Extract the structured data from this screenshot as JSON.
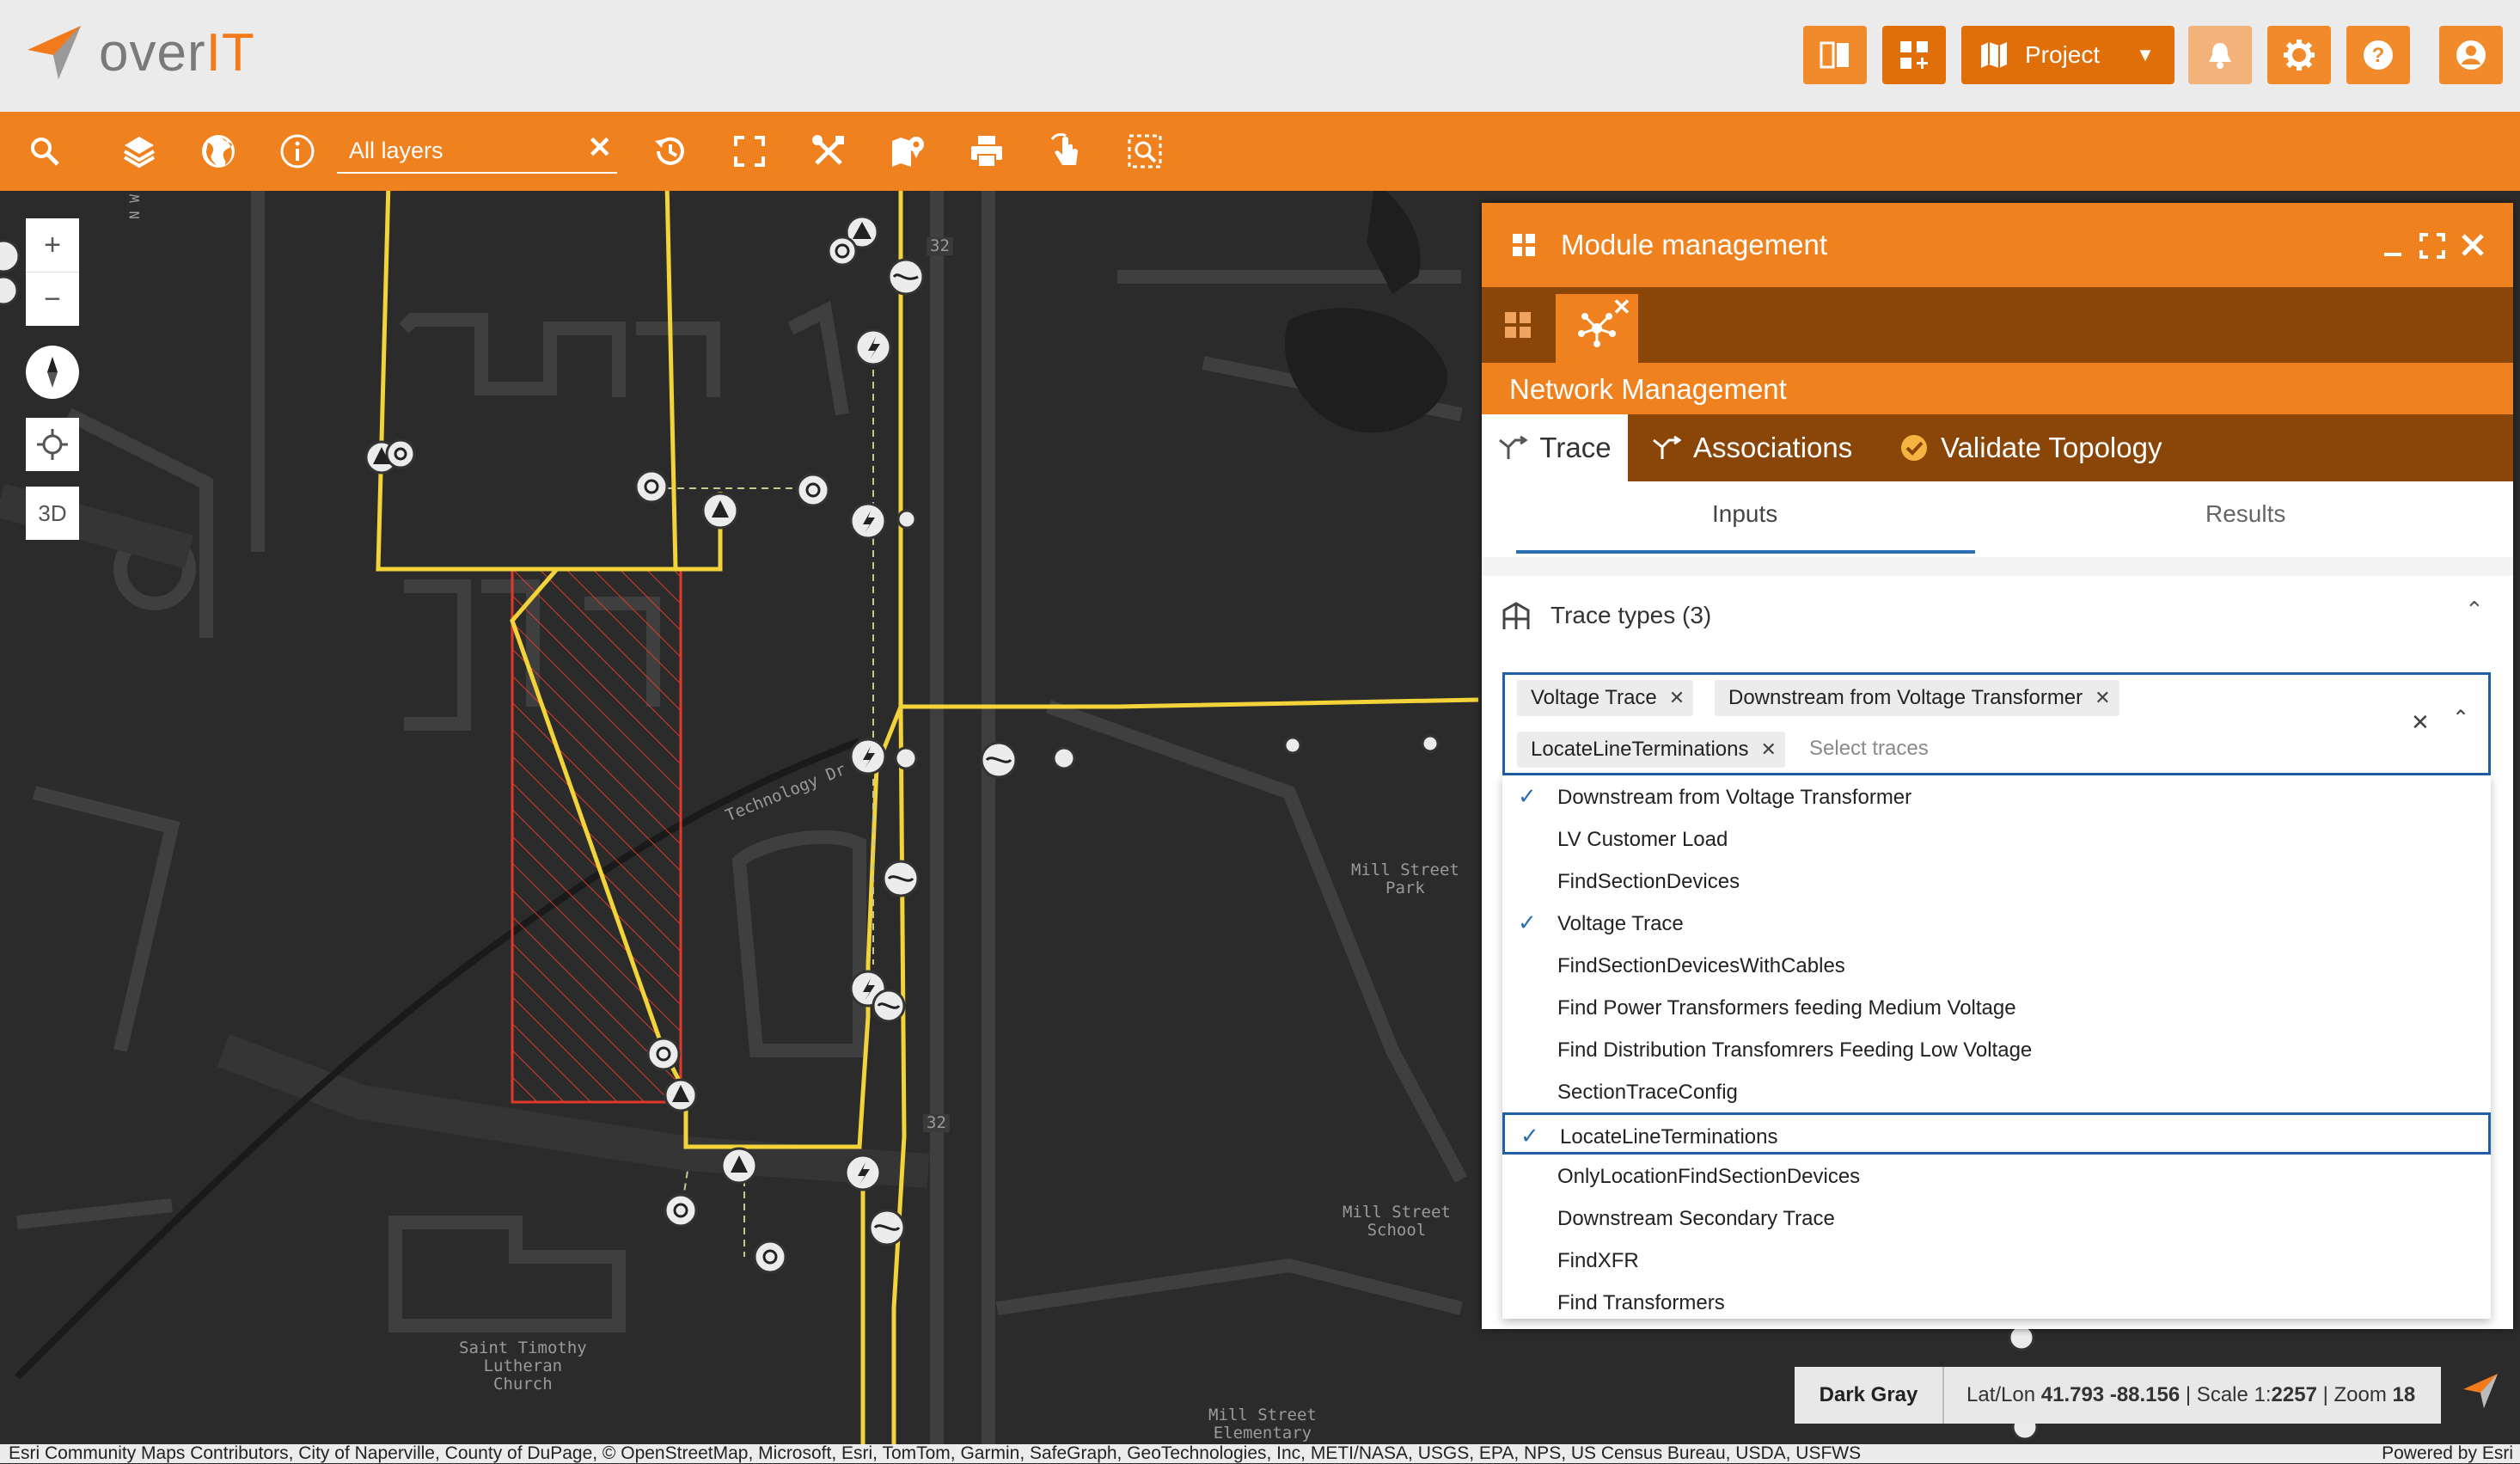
{
  "app": {
    "logo_text_a": "over",
    "logo_text_b": "IT"
  },
  "header": {
    "project_label": "Project",
    "buttons": [
      "split-view-icon",
      "add-widget-icon",
      "map-icon",
      "bell-icon",
      "gear-icon",
      "help-icon",
      "user-icon"
    ]
  },
  "toolbar": {
    "search_value": "All layers",
    "clear_symbol": "✕"
  },
  "map": {
    "zoom_in": "+",
    "zoom_out": "−",
    "mode_3d": "3D",
    "labels": {
      "road_technology": "Technology Dr",
      "park": "Mill Street\nPark",
      "school": "Mill Street\nSchool",
      "church": "Saint Timothy\nLutheran\nChurch",
      "elementary": "Mill Street\nElementary",
      "route_32_top": "32",
      "route_32_bottom": "32",
      "nw": "N W"
    }
  },
  "panel": {
    "title": "Module management",
    "network_title": "Network Management",
    "subtabs": {
      "trace": "Trace",
      "associations": "Associations",
      "validate": "Validate Topology"
    },
    "io_tabs": {
      "inputs": "Inputs",
      "results": "Results"
    },
    "trace_types_label": "Trace types (3)",
    "chips": [
      "Voltage Trace",
      "Downstream from Voltage Transformer",
      "LocateLineTerminations"
    ],
    "placeholder": "Select traces",
    "options": [
      {
        "label": "Downstream from Voltage Transformer",
        "checked": true
      },
      {
        "label": "LV Customer Load",
        "checked": false
      },
      {
        "label": "FindSectionDevices",
        "checked": false
      },
      {
        "label": "Voltage Trace",
        "checked": true
      },
      {
        "label": "FindSectionDevicesWithCables",
        "checked": false
      },
      {
        "label": "Find Power Transformers feeding Medium Voltage",
        "checked": false
      },
      {
        "label": "Find Distribution Transfomrers Feeding Low Voltage",
        "checked": false
      },
      {
        "label": "SectionTraceConfig",
        "checked": false
      },
      {
        "label": "LocateLineTerminations",
        "checked": true,
        "focused": true
      },
      {
        "label": "OnlyLocationFindSectionDevices",
        "checked": false
      },
      {
        "label": "Downstream Secondary Trace",
        "checked": false
      },
      {
        "label": "FindXFR",
        "checked": false
      },
      {
        "label": "Find Transformers",
        "checked": false
      }
    ]
  },
  "status": {
    "basemap": "Dark Gray",
    "latlon_label": "Lat/Lon ",
    "latlon_value": "41.793 -88.156",
    "scale_label": " | Scale 1:",
    "scale_value": "2257",
    "zoom_label": " | Zoom ",
    "zoom_value": "18"
  },
  "attribution": {
    "text": "Esri Community Maps Contributors, City of Naperville, County of DuPage, © OpenStreetMap, Microsoft, Esri, TomTom, Garmin, SafeGraph, GeoTechnologies, Inc, METI/NASA, USGS, EPA, NPS, US Census Bureau, USDA, USFWS",
    "powered": "Powered by Esri"
  },
  "colors": {
    "accent": "#f0811f",
    "accent_dark": "#8a4508",
    "line_yellow": "#f2d33a",
    "parcel_red": "#e0392b",
    "focus_blue": "#1f5fa8"
  }
}
